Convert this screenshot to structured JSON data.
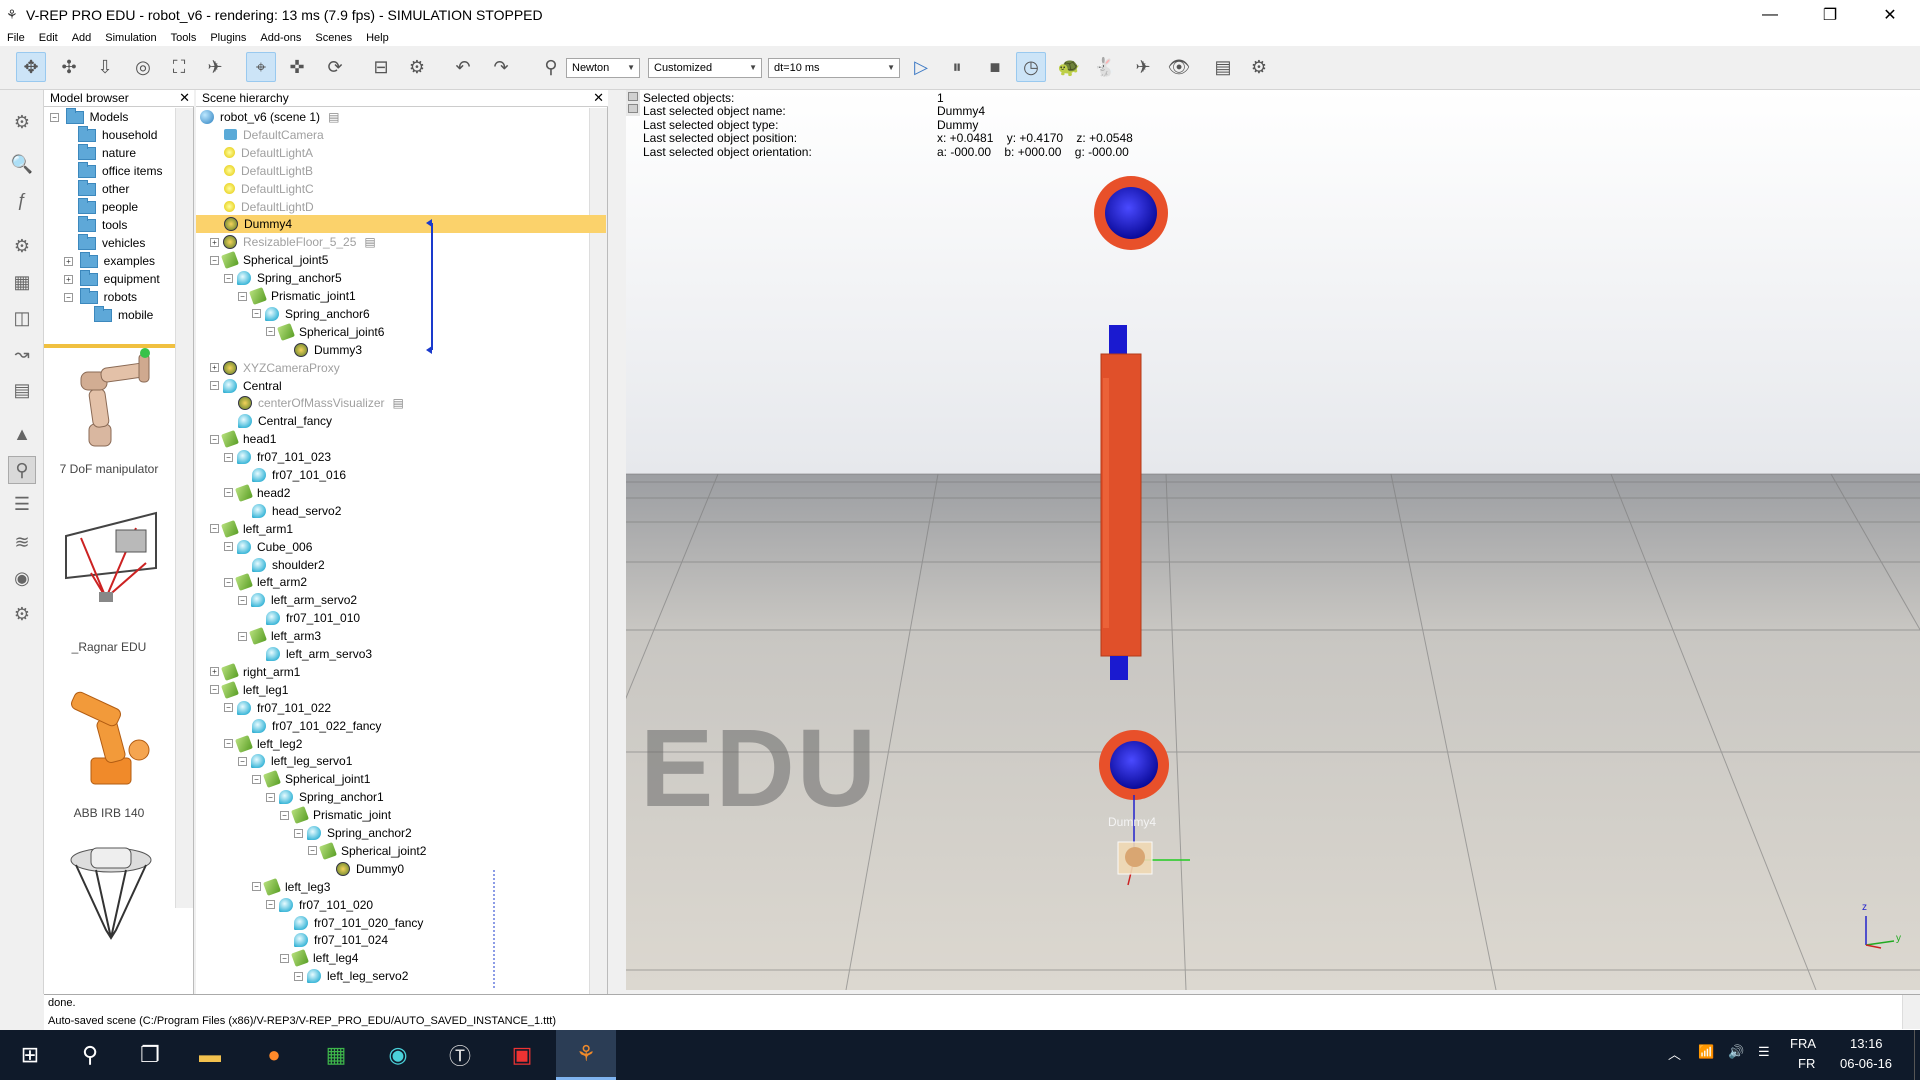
{
  "window": {
    "title": "V-REP PRO EDU - robot_v6 - rendering: 13 ms (7.9 fps) - SIMULATION STOPPED",
    "minimize": "—",
    "maximize": "❐",
    "close": "✕"
  },
  "menu": [
    "File",
    "Edit",
    "Add",
    "Simulation",
    "Tools",
    "Plugins",
    "Add-ons",
    "Scenes",
    "Help"
  ],
  "toolbar": {
    "engine": "Newton",
    "settings": "Customized",
    "timestep": "dt=10 ms"
  },
  "model_browser": {
    "title": "Model browser",
    "close": "✕",
    "tree": [
      {
        "label": "Models",
        "expand": "⊟"
      },
      {
        "label": "household"
      },
      {
        "label": "nature"
      },
      {
        "label": "office items"
      },
      {
        "label": "other"
      },
      {
        "label": "people"
      },
      {
        "label": "tools"
      },
      {
        "label": "vehicles"
      },
      {
        "label": "examples",
        "expand": "⊞"
      },
      {
        "label": "equipment",
        "expand": "⊞"
      },
      {
        "label": "robots",
        "expand": "⊟"
      },
      {
        "label": "mobile"
      }
    ],
    "thumbnails": [
      "7 DoF manipulator",
      "_Ragnar EDU",
      "ABB IRB 140",
      ""
    ]
  },
  "scene_hierarchy": {
    "title": "Scene hierarchy",
    "close": "✕",
    "rows": [
      {
        "label": "robot_v6 (scene 1)",
        "icon": "world"
      },
      {
        "label": "DefaultCamera",
        "icon": "cam"
      },
      {
        "label": "DefaultLightA",
        "icon": "light"
      },
      {
        "label": "DefaultLightB",
        "icon": "light"
      },
      {
        "label": "DefaultLightC",
        "icon": "light"
      },
      {
        "label": "DefaultLightD",
        "icon": "light"
      },
      {
        "label": "Dummy4",
        "icon": "dummy"
      },
      {
        "label": "ResizableFloor_5_25",
        "icon": "dummy"
      },
      {
        "label": "Spherical_joint5",
        "icon": "joint"
      },
      {
        "label": "Spring_anchor5",
        "icon": "shape"
      },
      {
        "label": "Prismatic_joint1",
        "icon": "joint"
      },
      {
        "label": "Spring_anchor6",
        "icon": "shape"
      },
      {
        "label": "Spherical_joint6",
        "icon": "joint"
      },
      {
        "label": "Dummy3",
        "icon": "dummy"
      },
      {
        "label": "XYZCameraProxy",
        "icon": "dummy"
      },
      {
        "label": "Central",
        "icon": "shape"
      },
      {
        "label": "centerOfMassVisualizer",
        "icon": "dummy"
      },
      {
        "label": "Central_fancy",
        "icon": "shape"
      },
      {
        "label": "head1",
        "icon": "joint"
      },
      {
        "label": "fr07_101_023",
        "icon": "shape"
      },
      {
        "label": "fr07_101_016",
        "icon": "shape"
      },
      {
        "label": "head2",
        "icon": "joint"
      },
      {
        "label": "head_servo2",
        "icon": "shape"
      },
      {
        "label": "left_arm1",
        "icon": "joint"
      },
      {
        "label": "Cube_006",
        "icon": "shape"
      },
      {
        "label": "shoulder2",
        "icon": "shape"
      },
      {
        "label": "left_arm2",
        "icon": "joint"
      },
      {
        "label": "left_arm_servo2",
        "icon": "shape"
      },
      {
        "label": "fr07_101_010",
        "icon": "shape"
      },
      {
        "label": "left_arm3",
        "icon": "joint"
      },
      {
        "label": "left_arm_servo3",
        "icon": "shape"
      },
      {
        "label": "right_arm1",
        "icon": "joint"
      },
      {
        "label": "left_leg1",
        "icon": "joint"
      },
      {
        "label": "fr07_101_022",
        "icon": "shape"
      },
      {
        "label": "fr07_101_022_fancy",
        "icon": "shape"
      },
      {
        "label": "left_leg2",
        "icon": "joint"
      },
      {
        "label": "left_leg_servo1",
        "icon": "shape"
      },
      {
        "label": "Spherical_joint1",
        "icon": "joint"
      },
      {
        "label": "Spring_anchor1",
        "icon": "shape"
      },
      {
        "label": "Prismatic_joint",
        "icon": "joint"
      },
      {
        "label": "Spring_anchor2",
        "icon": "shape"
      },
      {
        "label": "Spherical_joint2",
        "icon": "joint"
      },
      {
        "label": "Dummy0",
        "icon": "dummy"
      },
      {
        "label": "left_leg3",
        "icon": "joint"
      },
      {
        "label": "fr07_101_020",
        "icon": "shape"
      },
      {
        "label": "fr07_101_020_fancy",
        "icon": "shape"
      },
      {
        "label": "fr07_101_024",
        "icon": "shape"
      },
      {
        "label": "left_leg4",
        "icon": "joint"
      },
      {
        "label": "left_leg_servo2",
        "icon": "shape"
      }
    ]
  },
  "info": {
    "selected_objects_label": "Selected objects:",
    "selected_objects_value": "1",
    "name_label": "Last selected object name:",
    "name_value": "Dummy4",
    "type_label": "Last selected object type:",
    "type_value": "Dummy",
    "position_label": "Last selected object position:",
    "position_value": "x: +0.0481    y: +0.4170    z: +0.0548",
    "orientation_label": "Last selected object orientation:",
    "orientation_value": "a: -000.00    b: +000.00    g: -000.00"
  },
  "viewport": {
    "watermark": "EDU",
    "dummy_label": "Dummy4",
    "axis_z": "z",
    "axis_y": "y"
  },
  "status": {
    "line1": "done.",
    "line2": "Auto-saved scene (C:/Program Files (x86)/V-REP3/V-REP_PRO_EDU/AUTO_SAVED_INSTANCE_1.ttt)"
  },
  "taskbar": {
    "lang_top": "FRA",
    "lang_bottom": "FR",
    "time": "13:16",
    "date": "06-06-16"
  },
  "colors": {
    "selection": "#fbd26b",
    "sphere_outer": "#e8502a",
    "sphere_inner": "#1010c8",
    "bar": "#e0502a"
  }
}
